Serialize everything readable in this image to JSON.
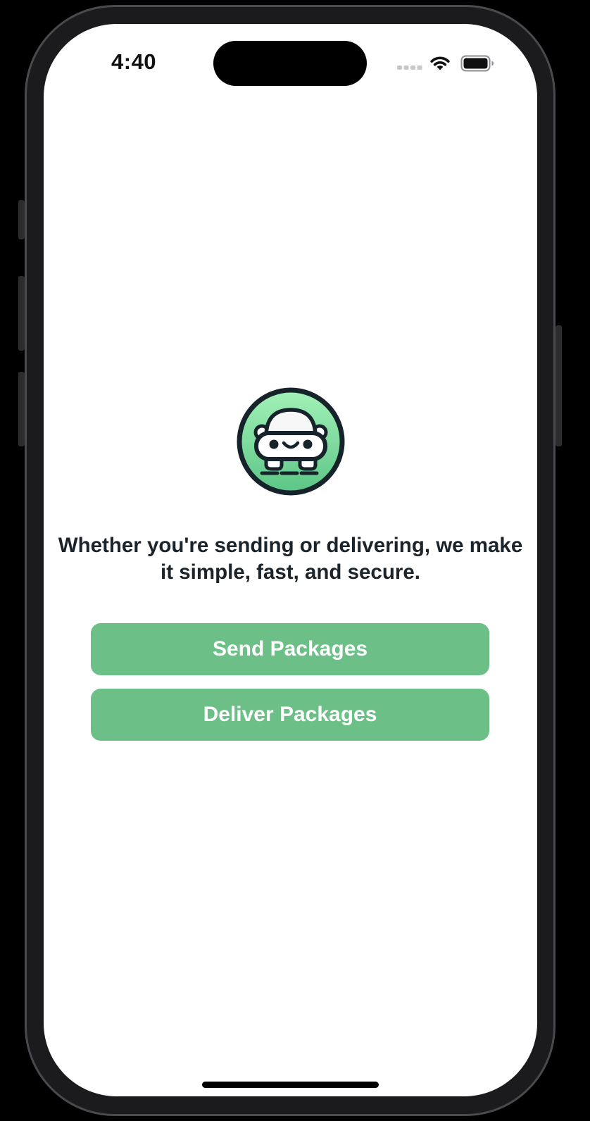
{
  "status_bar": {
    "time": "4:40",
    "signal_icon": "cellular-signal-icon",
    "wifi_icon": "wifi-icon",
    "battery_icon": "battery-icon"
  },
  "onboarding": {
    "logo_icon": "delivery-mascot-logo-icon",
    "headline": "Whether you're sending or delivering, we make it simple, fast, and secure.",
    "send_button_label": "Send Packages",
    "deliver_button_label": "Deliver Packages"
  },
  "colors": {
    "accent": "#6cbf86",
    "headline_text": "#1b232b",
    "background": "#ffffff",
    "logo_green_light": "#a3f2b8",
    "logo_green_dark": "#5cc585",
    "logo_outline": "#16232b"
  }
}
